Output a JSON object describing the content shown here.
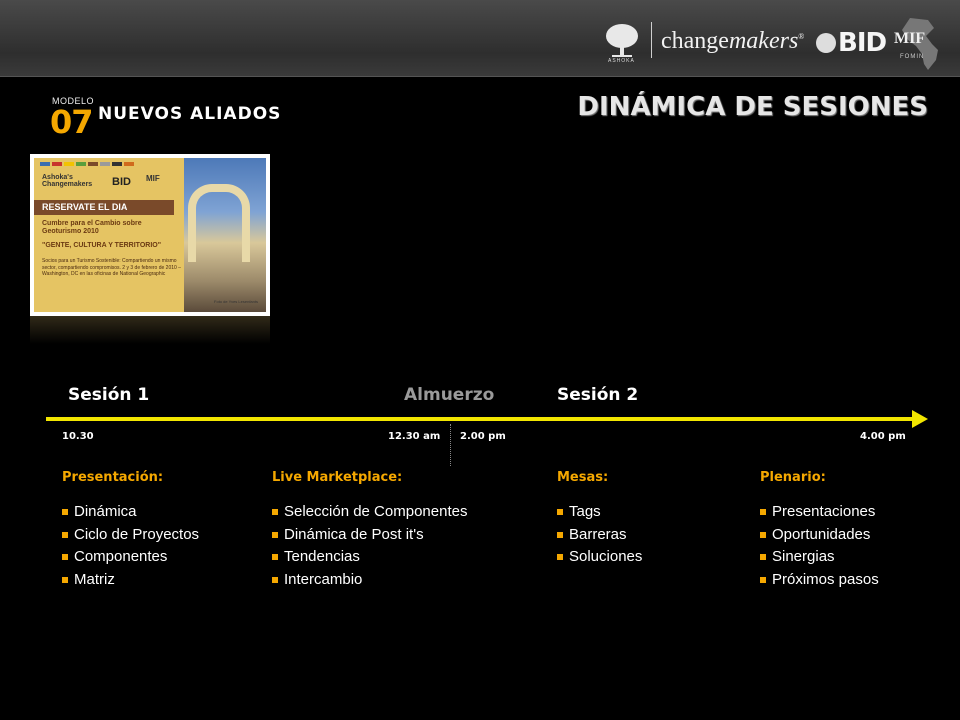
{
  "header": {
    "logos": {
      "ashoka": "ASHOKA",
      "changemakers_main": "change",
      "changemakers_italic": "makers",
      "changemakers_mark": "®",
      "bid": "BID",
      "mif": "MIF",
      "mif_sub": "FOMIN"
    }
  },
  "module": {
    "label": "MODELO",
    "number": "07",
    "name": "NUEVOS ALIADOS"
  },
  "title": "DINÁMICA DE SESIONES",
  "flyer": {
    "org": "Ashoka's",
    "org_name": "Changemakers",
    "bid": "BID",
    "mif": "MIF",
    "banner": "RESERVATE EL DIA",
    "event": "Cumbre para el Cambio sobre Geoturismo 2010",
    "slogan": "\"GENTE, CULTURA Y TERRITORIO\"",
    "details": "Socios para un Turismo Sostenible: Compartiendo un mismo sector, compartiendo compromisos. 2 y 3 de febrero de 2010 – Washington, DC en las oficinas de National Geographic",
    "credit": "Foto de Yves Lesenfants",
    "stripe_colors": [
      "#3b6fb0",
      "#c8342c",
      "#f2c300",
      "#5a9e3c",
      "#7a4a2a",
      "#9a9a9a",
      "#333333",
      "#d06a1c"
    ]
  },
  "timeline": {
    "sessions": [
      {
        "label": "Sesión 1",
        "muted": false
      },
      {
        "label": "Almuerzo",
        "muted": true
      },
      {
        "label": "Sesión 2",
        "muted": false
      }
    ],
    "times": [
      "10.30",
      "12.30 am",
      "2.00 pm",
      "4.00 pm"
    ]
  },
  "columns": [
    {
      "heading": "Presentación:",
      "items": [
        "Dinámica",
        "Ciclo de Proyectos",
        "Componentes",
        "Matriz"
      ]
    },
    {
      "heading": "Live Marketplace:",
      "items": [
        "Selección de Componentes",
        "Dinámica de Post it's",
        "Tendencias",
        "Intercambio"
      ]
    },
    {
      "heading": "Mesas:",
      "items": [
        "Tags",
        "Barreras",
        "Soluciones"
      ]
    },
    {
      "heading": "Plenario:",
      "items": [
        "Presentaciones",
        "Oportunidades",
        "Sinergias",
        "Próximos pasos"
      ]
    }
  ],
  "colors": {
    "accent": "#f5a800",
    "timeline": "#f2e600",
    "background": "#000000",
    "muted": "#9a9a9a"
  }
}
